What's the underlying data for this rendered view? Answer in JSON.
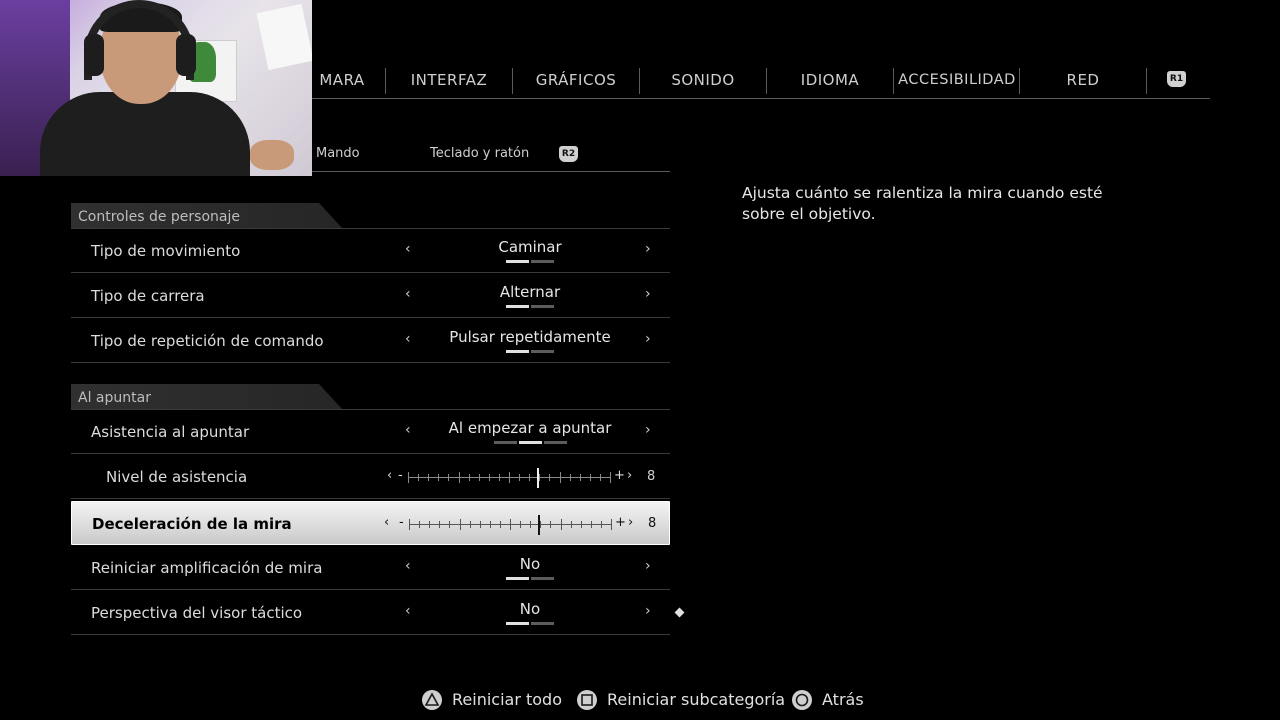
{
  "tabs": [
    {
      "label": "MARA"
    },
    {
      "label": "INTERFAZ"
    },
    {
      "label": "GRÁFICOS"
    },
    {
      "label": "SONIDO"
    },
    {
      "label": "IDIOMA"
    },
    {
      "label": "ACCESIBILIDAD"
    },
    {
      "label": "RED"
    }
  ],
  "tab_next_button": "R1",
  "subtabs": {
    "mando": "Mando",
    "teclado": "Teclado y ratón",
    "next_button": "R2"
  },
  "sections": {
    "personaje": "Controles de personaje",
    "apuntar": "Al apuntar"
  },
  "rows": {
    "movimiento": {
      "label": "Tipo de movimiento",
      "value": "Caminar",
      "options": 2,
      "selected": 0
    },
    "carrera": {
      "label": "Tipo de carrera",
      "value": "Alternar",
      "options": 2,
      "selected": 0
    },
    "repeticion": {
      "label": "Tipo de repetición de comando",
      "value": "Pulsar repetidamente",
      "options": 2,
      "selected": 0
    },
    "asistencia": {
      "label": "Asistencia al apuntar",
      "value": "Al empezar a apuntar",
      "options": 3,
      "selected": 1
    },
    "nivel": {
      "label": "Nivel de asistencia",
      "value": "8",
      "min": 0,
      "max": 10
    },
    "deceleracion": {
      "label": "Deceleración de la mira",
      "value": "8",
      "min": 0,
      "max": 10
    },
    "amplificacion": {
      "label": "Reiniciar amplificación de mira",
      "value": "No",
      "options": 2,
      "selected": 0
    },
    "visor": {
      "label": "Perspectiva del visor táctico",
      "value": "No",
      "options": 2,
      "selected": 0
    }
  },
  "slider_symbols": {
    "left_arrow": "‹",
    "minus": "-",
    "plus": "+",
    "right_arrow": "›"
  },
  "arrows": {
    "left": "‹",
    "right": "›"
  },
  "description": "Ajusta cuánto se ralentiza la mira cuando esté sobre el objetivo.",
  "footer": {
    "reset_all": "Reiniciar todo",
    "reset_sub": "Reiniciar subcategoría",
    "back": "Atrás"
  },
  "colors": {
    "background": "#000000",
    "selected_row": "#e6e6e6",
    "text": "#dcdcdc"
  }
}
